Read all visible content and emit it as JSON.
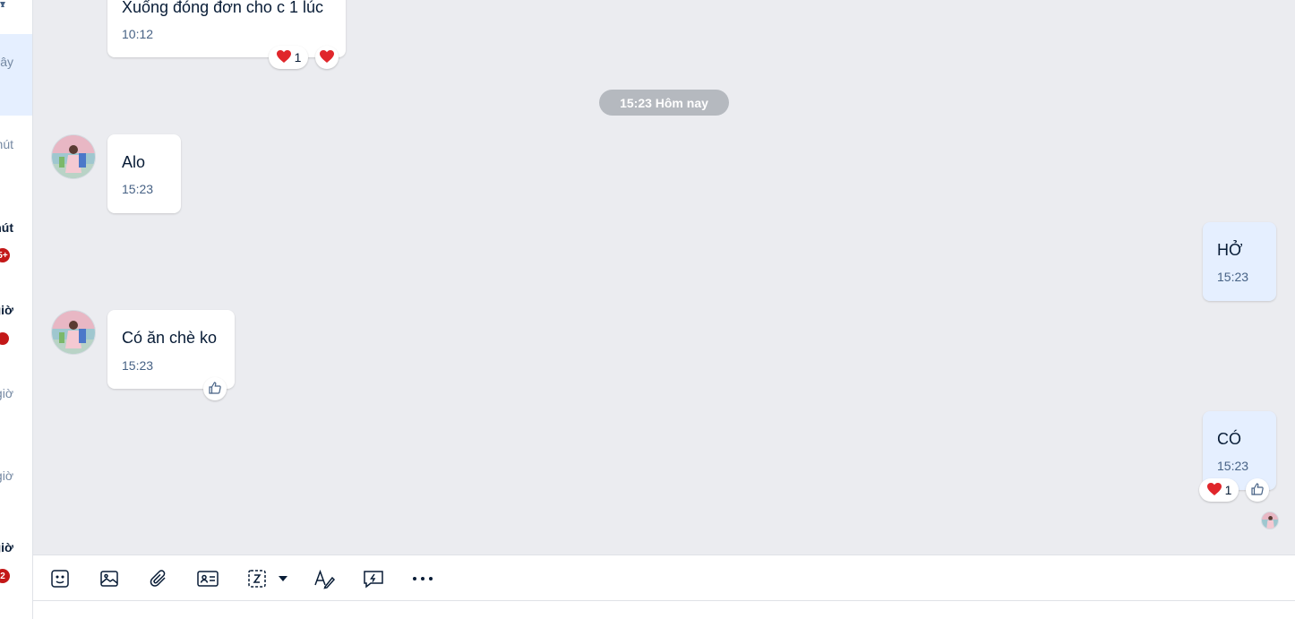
{
  "sidebar": {
    "items": [
      {
        "time": "ây",
        "bold": false
      },
      {
        "time": "hút",
        "bold": false
      },
      {
        "time": "hút",
        "bold": true,
        "badge": "5+"
      },
      {
        "time": "giờ",
        "bold": true,
        "dot": true
      },
      {
        "time": "giờ",
        "bold": false
      },
      {
        "time": "giờ",
        "bold": false
      },
      {
        "time": "giờ",
        "bold": true,
        "badge": "2"
      }
    ]
  },
  "messages": {
    "m0": {
      "text": "Xuống đóng đơn cho c 1 lúc",
      "time": "10:12"
    },
    "date_separator": "15:23 Hôm nay",
    "m1": {
      "text": "Alo",
      "time": "15:23"
    },
    "m2": {
      "text": "HỞ",
      "time": "15:23"
    },
    "m3": {
      "text": "Có ăn chè ko",
      "time": "15:23"
    },
    "m4": {
      "text": "CÓ",
      "time": "15:23"
    }
  },
  "reactions": {
    "m0_heart_count": "1",
    "m4_heart_count": "1"
  },
  "icons": {
    "heart": "heart-icon",
    "like": "thumbs-up-icon"
  },
  "toolbar": {
    "items": [
      "sticker-icon",
      "image-icon",
      "attachment-icon",
      "contact-card-icon",
      "screenshot-icon",
      "format-text-icon",
      "quick-message-icon",
      "more-icon"
    ]
  },
  "colors": {
    "chat_bg": "#ebecf0",
    "my_bubble": "#e5efff",
    "heart": "#e0262b",
    "badge": "#c31818"
  }
}
